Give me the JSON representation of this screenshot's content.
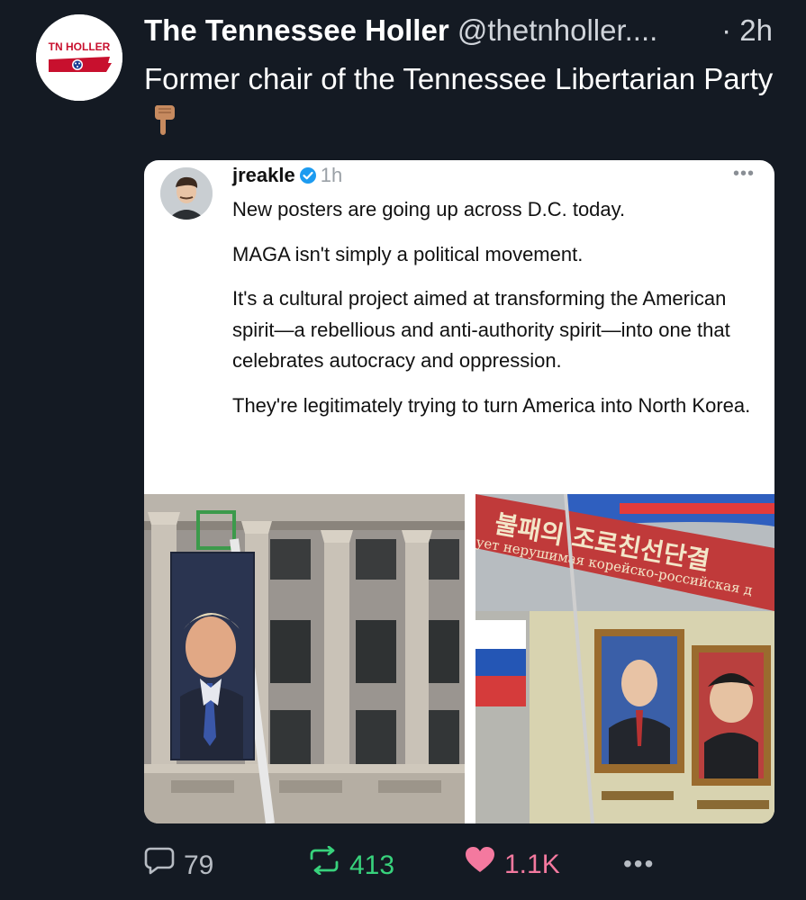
{
  "post": {
    "avatar_label": "TN HOLLER",
    "display_name": "The Tennessee Holler",
    "handle": "@thetnholler....",
    "separator": "·",
    "time": "2h",
    "text": "Former chair of the Tennessee Libertarian Party",
    "emoji_icon": "backhand-index-pointing-down-icon"
  },
  "quote": {
    "username": "jreakle",
    "time": "1h",
    "more": "•••",
    "paragraphs": [
      "New posters are going up across D.C. today.",
      "MAGA isn't simply a political movement.",
      "It's a cultural project aimed at transforming the American spirit—a rebellious and anti-authority spirit—into one that celebrates autocracy and oppression.",
      "They're legitimately trying to turn America into North Korea."
    ],
    "images": [
      {
        "icon": "trump-banner-on-building-photo"
      },
      {
        "icon": "putin-kim-portraits-photo",
        "sign_korean": "불패의 조로친선단결",
        "sign_russian": "ует нерушимая корейско-российская д"
      }
    ]
  },
  "actions": {
    "reply_count": "79",
    "retweet_count": "413",
    "like_count": "1.1K",
    "more": "•••"
  },
  "colors": {
    "background": "#141a23",
    "retweet": "#38d27c",
    "like": "#f4799f",
    "muted": "#b7bcc3",
    "verified": "#1d9bf0"
  }
}
